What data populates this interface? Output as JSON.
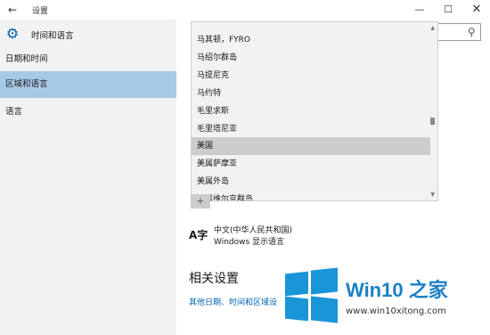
{
  "window": {
    "title": "设置",
    "back_glyph": "←",
    "minimize_glyph": "—",
    "maximize_glyph": "☐",
    "close_glyph": "✕"
  },
  "sidebar": {
    "header": "时间和语言",
    "items": [
      {
        "label": "日期和时间",
        "active": false
      },
      {
        "label": "区域和语言",
        "active": true
      },
      {
        "label": "语言",
        "active": false
      }
    ]
  },
  "language_dropdown": {
    "items": [
      "马其顿，FYRO",
      "马绍尔群岛",
      "马提尼克",
      "马约特",
      "毛里求斯",
      "毛里塔尼亚",
      "美国",
      "美属萨摩亚",
      "美属外岛",
      "美属维尔京群岛"
    ],
    "selected": "美国"
  },
  "add_button_glyph": "+",
  "language_entry": {
    "icon_text": "A字",
    "name": "中文(中华人民共和国)",
    "subtitle": "Windows 显示语言"
  },
  "related": {
    "title": "相关设置",
    "link": "其他日期、时间和区域设"
  },
  "watermark": {
    "title": "Win10 之家",
    "url": "www.win10xitong.com"
  },
  "colors": {
    "accent": "#0063b1",
    "sidebar_bg": "#f2f2f2",
    "sidebar_active": "#a6c9e6",
    "dropdown_bg": "#f2f2f2",
    "dropdown_selected": "#cccccc",
    "watermark_blue": "#1a95d8"
  }
}
